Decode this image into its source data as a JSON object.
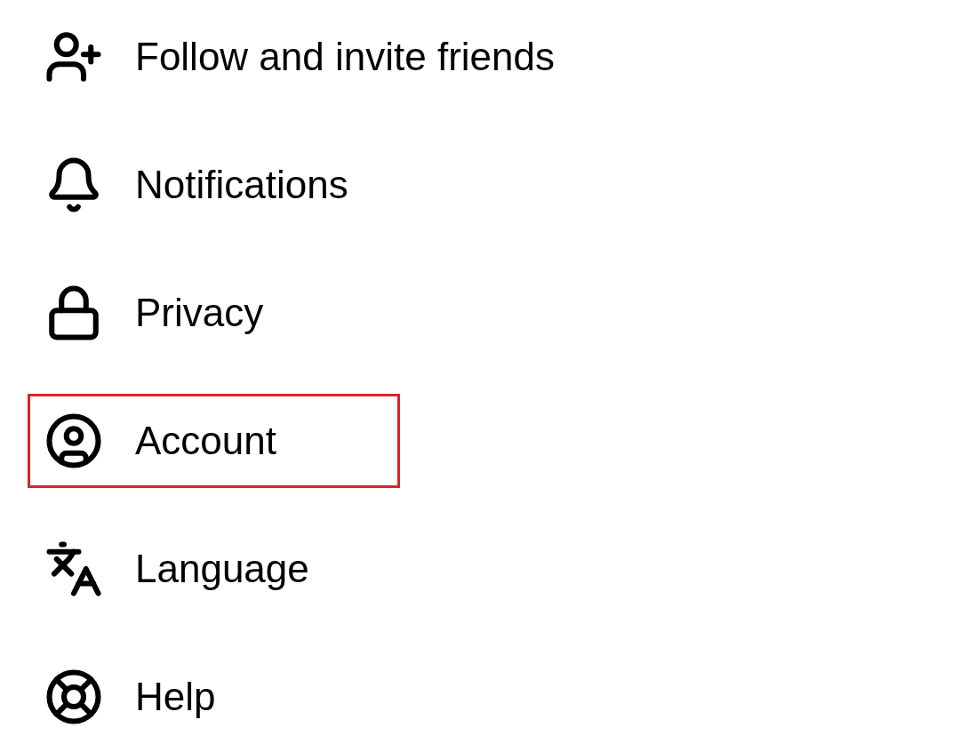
{
  "menu_items": [
    {
      "kind": "add-person",
      "label": "Follow and invite friends",
      "highlighted": false
    },
    {
      "kind": "bell",
      "label": "Notifications",
      "highlighted": false
    },
    {
      "kind": "lock",
      "label": "Privacy",
      "highlighted": false
    },
    {
      "kind": "account",
      "label": "Account",
      "highlighted": true
    },
    {
      "kind": "language",
      "label": "Language",
      "highlighted": false
    },
    {
      "kind": "help",
      "label": "Help",
      "highlighted": false
    }
  ]
}
